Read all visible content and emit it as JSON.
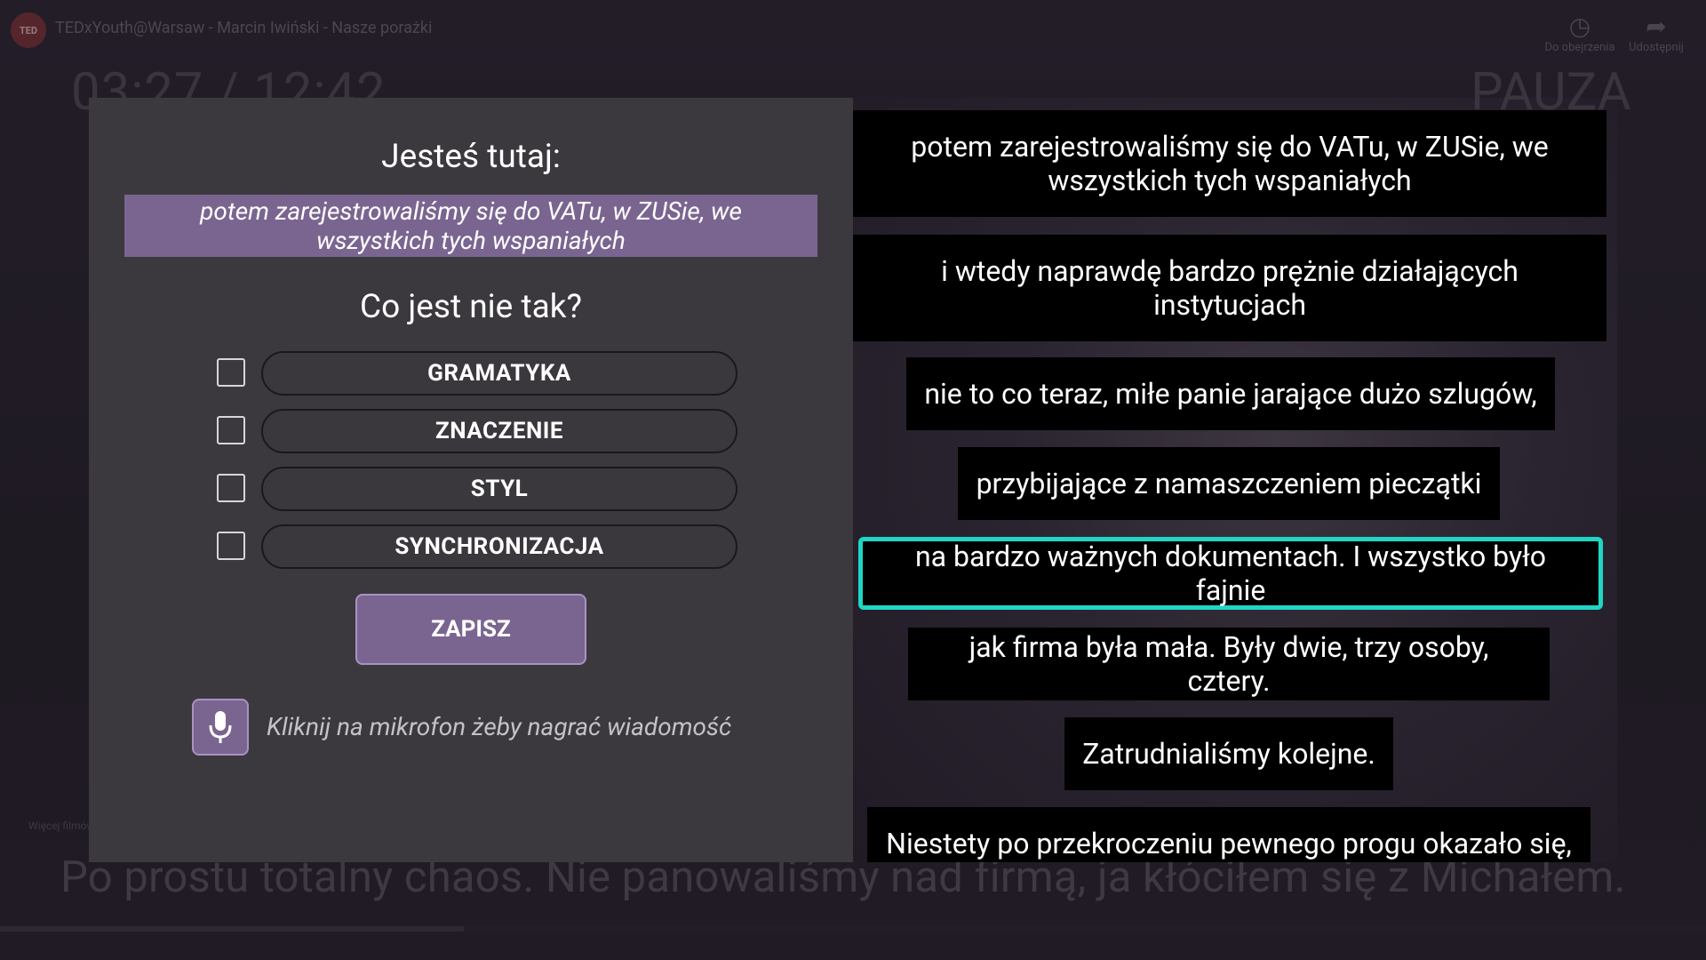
{
  "player": {
    "logo_text": "TED",
    "video_title": "TEDxYouth@Warsaw - Marcin Iwiński - Nasze porażki",
    "watch_later_label": "Do obejrzenia",
    "share_label": "Udostępnij",
    "time_display": "03:27 / 12:42",
    "status_label": "PAUZA",
    "more_films_label": "Więcej filmów",
    "progress_fraction": 0.272,
    "background_subtitle": "Po prostu totalny chaos. Nie panowaliśmy nad firmą, ja kłóciłem się z Michałem."
  },
  "panel": {
    "heading": "Jesteś tutaj:",
    "current_line": "potem zarejestrowaliśmy się do VATu, w ZUSie, we wszystkich tych wspaniałych",
    "question": "Co jest nie tak?",
    "options": [
      {
        "label": "GRAMATYKA",
        "checked": false
      },
      {
        "label": "ZNACZENIE",
        "checked": false
      },
      {
        "label": "STYL",
        "checked": false
      },
      {
        "label": "SYNCHRONIZACJA",
        "checked": false
      }
    ],
    "save_label": "ZAPISZ",
    "mic_icon": "microphone-icon",
    "mic_hint": "Kliknij na mikrofon żeby nagrać wiadomość"
  },
  "subtitles": [
    {
      "text": "potem zarejestrowaliśmy się do VATu, w ZUSie, we wszystkich tych wspaniałych",
      "active": false
    },
    {
      "text": "i wtedy naprawdę bardzo prężnie działających instytucjach",
      "active": false
    },
    {
      "text": "nie to co teraz, miłe panie jarające dużo szlugów,",
      "active": false
    },
    {
      "text": "przybijające z namaszczeniem pieczątki",
      "active": false
    },
    {
      "text": "na bardzo ważnych dokumentach. I wszystko było fajnie",
      "active": true
    },
    {
      "text": "jak firma była mała. Były dwie, trzy osoby, cztery.",
      "active": false
    },
    {
      "text": "Zatrudnialiśmy kolejne.",
      "active": false
    },
    {
      "text": "Niestety po przekroczeniu pewnego progu okazało się,",
      "active": false
    }
  ],
  "colors": {
    "accent_purple": "#7a6591",
    "active_outline": "#1fd6c4",
    "panel_bg": "#3b393d"
  }
}
